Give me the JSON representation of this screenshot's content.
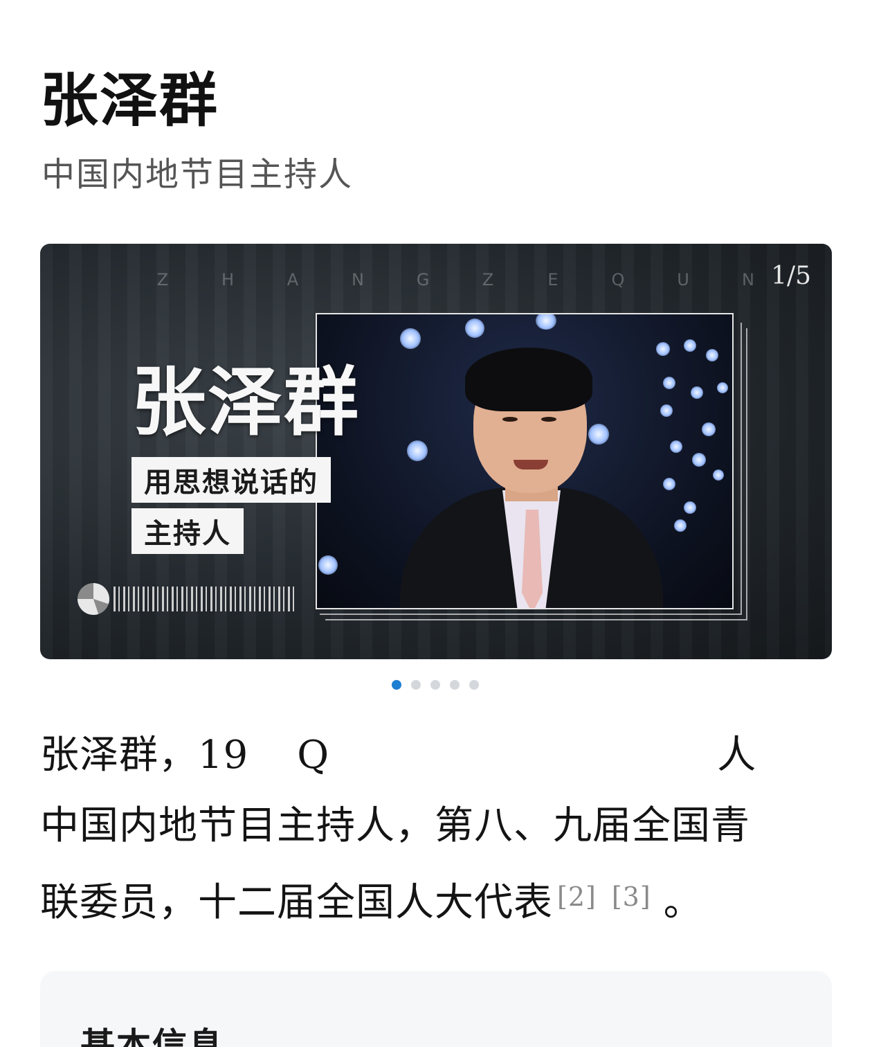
{
  "header": {
    "title": "张泽群",
    "subtitle": "中国内地节目主持人"
  },
  "banner": {
    "pinyin": [
      "Z",
      "H",
      "A",
      "N",
      "G",
      "Z",
      "E",
      "Q",
      "U",
      "N"
    ],
    "counter": "1/5",
    "name": "张泽群",
    "tag_line1": "用思想说话的",
    "tag_line2": "主持人",
    "active_slide": 1,
    "total_slides": 5
  },
  "summary": {
    "line1": "张泽群，19",
    "line1_tail": "Q",
    "line1_end": "人",
    "line2": "中国内地节目主持人，第八、九届全国青",
    "line3": "联委员，十二届全国人大代表",
    "citations": [
      "[2]",
      "[3]"
    ],
    "line3_end": "。"
  },
  "info_card": {
    "title": "基本信息"
  },
  "colors": {
    "active_dot": "#1d7fd1",
    "inactive_dot": "#d4d8dc",
    "card_bg": "#f6f7f9"
  }
}
